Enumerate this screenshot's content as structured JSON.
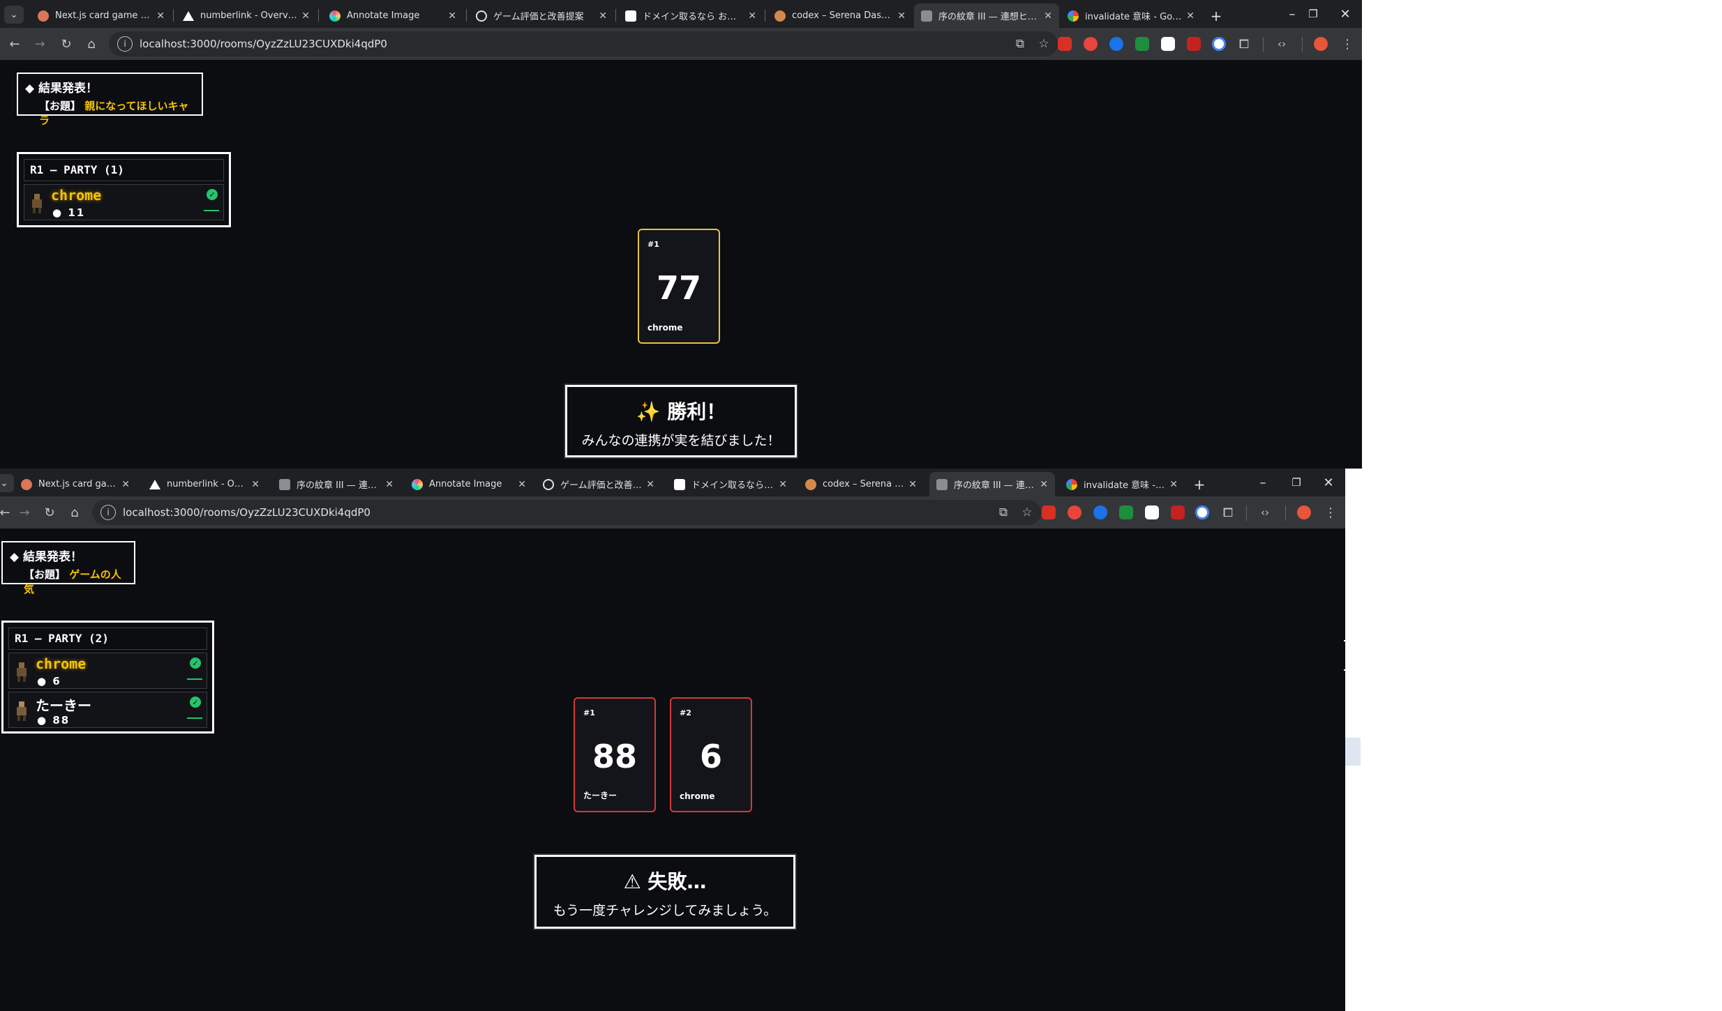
{
  "colors": {
    "tab_bar": "#1f2023",
    "toolbar": "#35363a",
    "page_bg": "#0c0d10",
    "highlight": "#f5c400",
    "success_border": "#e8c341",
    "fail_border": "#d43a3a",
    "check": "#27c46b"
  },
  "top": {
    "tabs": [
      {
        "label": "Next.js card game with Cl",
        "icon": "claude-icon",
        "active": false
      },
      {
        "label": "numberlink - Overview – V",
        "icon": "vercel-icon",
        "active": false
      },
      {
        "label": "Annotate Image",
        "icon": "annotate-icon",
        "active": false
      },
      {
        "label": "ゲーム評価と改善提案",
        "icon": "chatgpt-icon",
        "active": false
      },
      {
        "label": "ドメイン取るなら お名前.com",
        "icon": "onamae-icon",
        "active": false
      },
      {
        "label": "codex – Serena Dashboar",
        "icon": "serena-icon",
        "active": false
      },
      {
        "label": "序の紋章 III — 連想ヒントで",
        "icon": "game-icon",
        "active": true
      },
      {
        "label": "invalidate 意味 - Google 検",
        "icon": "google-icon",
        "active": false
      }
    ],
    "url": "localhost:3000/rooms/OyzZzLU23CUXDki4qdP0",
    "topic_header": "◆ 結果発表！",
    "topic_label": "【お題】",
    "topic_value": "親になってほしいキャラ",
    "party_title": "R1 – PARTY (1)",
    "players": [
      {
        "name": "chrome",
        "count": "11",
        "style": "gold"
      }
    ],
    "cards": [
      {
        "index": "#1",
        "value": "77",
        "player": "chrome"
      }
    ],
    "result_icon": "✨",
    "result_title": "勝利！",
    "result_message": "みんなの連携が実を結びました！"
  },
  "bottom": {
    "tabs": [
      {
        "label": "Next.js card game wit",
        "icon": "claude-icon",
        "active": false
      },
      {
        "label": "numberlink - Overvie",
        "icon": "vercel-icon",
        "active": false
      },
      {
        "label": "序の紋章 III — 連想ヒ",
        "icon": "game-icon",
        "active": false
      },
      {
        "label": "Annotate Image",
        "icon": "annotate-icon",
        "active": false
      },
      {
        "label": "ゲーム評価と改善提案",
        "icon": "chatgpt-icon",
        "active": false
      },
      {
        "label": "ドメイン取るなら お名前",
        "icon": "onamae-icon",
        "active": false
      },
      {
        "label": "codex – Serena Dash",
        "icon": "serena-icon",
        "active": false
      },
      {
        "label": "序の紋章 III — 連想ヒ",
        "icon": "game-icon",
        "active": true
      },
      {
        "label": "invalidate 意味 - Goo",
        "icon": "google-icon",
        "active": false
      }
    ],
    "url": "localhost:3000/rooms/OyzZzLU23CUXDki4qdP0",
    "topic_header": "◆ 結果発表！",
    "topic_label": "【お題】",
    "topic_value": "ゲームの人気",
    "party_title": "R1 – PARTY (2)",
    "players": [
      {
        "name": "chrome",
        "count": "6",
        "style": "gold"
      },
      {
        "name": "たーきー",
        "count": "88",
        "style": "white"
      }
    ],
    "cards": [
      {
        "index": "#1",
        "value": "88",
        "player": "たーきー"
      },
      {
        "index": "#2",
        "value": "6",
        "player": "chrome"
      }
    ],
    "result_icon": "⚠",
    "result_title": "失敗…",
    "result_message": "もう一度チャレンジしてみましょう。"
  }
}
